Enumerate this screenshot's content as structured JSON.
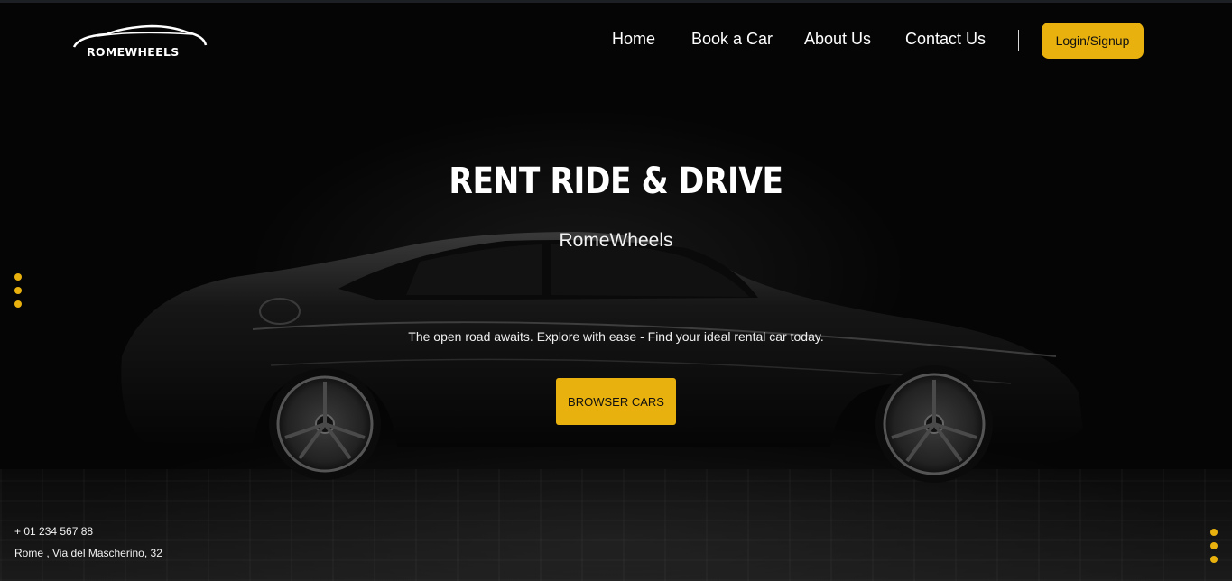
{
  "brand": {
    "name": "ROMEWHEELS"
  },
  "nav": {
    "items": [
      {
        "label": "Home"
      },
      {
        "label": "Book a Car"
      },
      {
        "label": "About Us"
      },
      {
        "label": "Contact Us"
      }
    ],
    "login_label": "Login/Signup"
  },
  "hero": {
    "title": "RENT RIDE & DRIVE",
    "subtitle": "RomeWheels",
    "tagline": "The open road awaits. Explore with ease - Find your ideal rental car today.",
    "cta_label": "BROWSER CARS"
  },
  "contact": {
    "phone": "+ 01 234 567 88",
    "address": "Rome , Via del Mascherino, 32"
  },
  "colors": {
    "accent": "#e9b10e",
    "background": "#000000",
    "text": "#ffffff"
  }
}
